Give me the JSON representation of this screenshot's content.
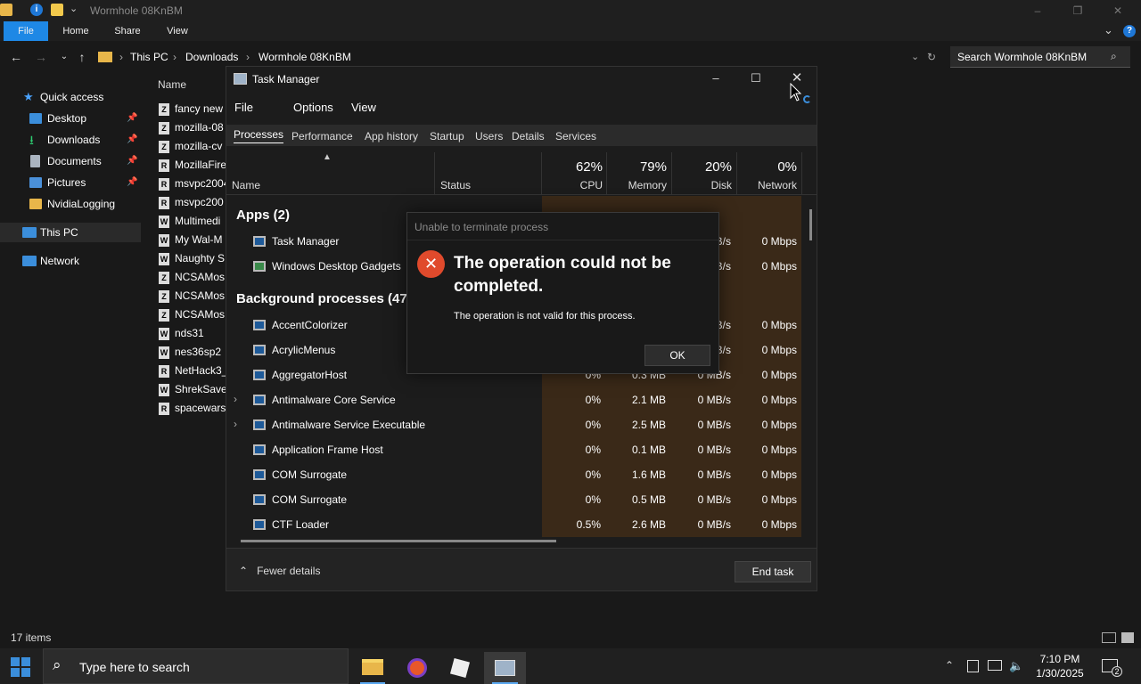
{
  "explorer": {
    "title": "Wormhole 08KnBM",
    "ribbon_tabs": [
      "File",
      "Home",
      "Share",
      "View"
    ],
    "breadcrumb": [
      "This PC",
      "Downloads",
      "Wormhole 08KnBM"
    ],
    "search_placeholder": "Search Wormhole 08KnBM",
    "column_name": "Name",
    "nav": {
      "quick_access": "Quick access",
      "items": [
        "Desktop",
        "Downloads",
        "Documents",
        "Pictures",
        "NvidiaLogging"
      ],
      "this_pc": "This PC",
      "network": "Network"
    },
    "files": [
      {
        "icon": "Z",
        "name": "fancy new"
      },
      {
        "icon": "Z",
        "name": "mozilla-08"
      },
      {
        "icon": "Z",
        "name": "mozilla-cv"
      },
      {
        "icon": "R",
        "name": "MozillaFire"
      },
      {
        "icon": "R",
        "name": "msvpc2004"
      },
      {
        "icon": "R",
        "name": "msvpc200"
      },
      {
        "icon": "W",
        "name": "Multimedi"
      },
      {
        "icon": "W",
        "name": "My Wal-M"
      },
      {
        "icon": "W",
        "name": "Naughty S"
      },
      {
        "icon": "Z",
        "name": "NCSAMos"
      },
      {
        "icon": "Z",
        "name": "NCSAMos"
      },
      {
        "icon": "Z",
        "name": "NCSAMos"
      },
      {
        "icon": "W",
        "name": "nds31"
      },
      {
        "icon": "W",
        "name": "nes36sp2"
      },
      {
        "icon": "R",
        "name": "NetHack3_"
      },
      {
        "icon": "W",
        "name": "ShrekSave"
      },
      {
        "icon": "R",
        "name": "spacewars"
      }
    ],
    "status": "17 items"
  },
  "taskmanager": {
    "title": "Task Manager",
    "menu": [
      "File",
      "Options",
      "View"
    ],
    "tabs": [
      "Processes",
      "Performance",
      "App history",
      "Startup",
      "Users",
      "Details",
      "Services"
    ],
    "columns": {
      "name": "Name",
      "status": "Status",
      "cpu": {
        "pct": "62%",
        "label": "CPU"
      },
      "memory": {
        "pct": "79%",
        "label": "Memory"
      },
      "disk": {
        "pct": "20%",
        "label": "Disk"
      },
      "network": {
        "pct": "0%",
        "label": "Network"
      }
    },
    "apps_header": "Apps (2)",
    "apps": [
      {
        "name": "Task Manager",
        "disk": "B/s",
        "network": "0 Mbps"
      },
      {
        "name": "Windows Desktop Gadgets",
        "disk": "B/s",
        "network": "0 Mbps"
      }
    ],
    "bg_header": "Background processes (47",
    "processes": [
      {
        "name": "AccentColorizer",
        "expand": "",
        "cpu": "",
        "mem": "",
        "disk": "B/s",
        "network": "0 Mbps"
      },
      {
        "name": "AcrylicMenus",
        "expand": "",
        "cpu": "",
        "mem": "",
        "disk": "B/s",
        "network": "0 Mbps"
      },
      {
        "name": "AggregatorHost",
        "expand": "",
        "cpu": "0%",
        "mem": "0.3 MB",
        "disk": "0 MB/s",
        "network": "0 Mbps"
      },
      {
        "name": "Antimalware Core Service",
        "expand": "›",
        "cpu": "0%",
        "mem": "2.1 MB",
        "disk": "0 MB/s",
        "network": "0 Mbps"
      },
      {
        "name": "Antimalware Service Executable",
        "expand": "›",
        "cpu": "0%",
        "mem": "2.5 MB",
        "disk": "0 MB/s",
        "network": "0 Mbps"
      },
      {
        "name": "Application Frame Host",
        "expand": "",
        "cpu": "0%",
        "mem": "0.1 MB",
        "disk": "0 MB/s",
        "network": "0 Mbps"
      },
      {
        "name": "COM Surrogate",
        "expand": "",
        "cpu": "0%",
        "mem": "1.6 MB",
        "disk": "0 MB/s",
        "network": "0 Mbps"
      },
      {
        "name": "COM Surrogate",
        "expand": "",
        "cpu": "0%",
        "mem": "0.5 MB",
        "disk": "0 MB/s",
        "network": "0 Mbps"
      },
      {
        "name": "CTF Loader",
        "expand": "",
        "cpu": "0.5%",
        "mem": "2.6 MB",
        "disk": "0 MB/s",
        "network": "0 Mbps"
      }
    ],
    "fewer_details": "Fewer details",
    "end_task": "End task"
  },
  "dialog": {
    "title": "Unable to terminate process",
    "heading": "The operation could not be completed.",
    "message": "The operation is not valid for this process.",
    "ok": "OK"
  },
  "taskbar": {
    "search_placeholder": "Type here to search",
    "time": "7:10 PM",
    "date": "1/30/2025",
    "notifications": "2"
  },
  "colors": {
    "accent": "#0078d4",
    "error": "#e04a2c",
    "heat": "#3a2918"
  }
}
